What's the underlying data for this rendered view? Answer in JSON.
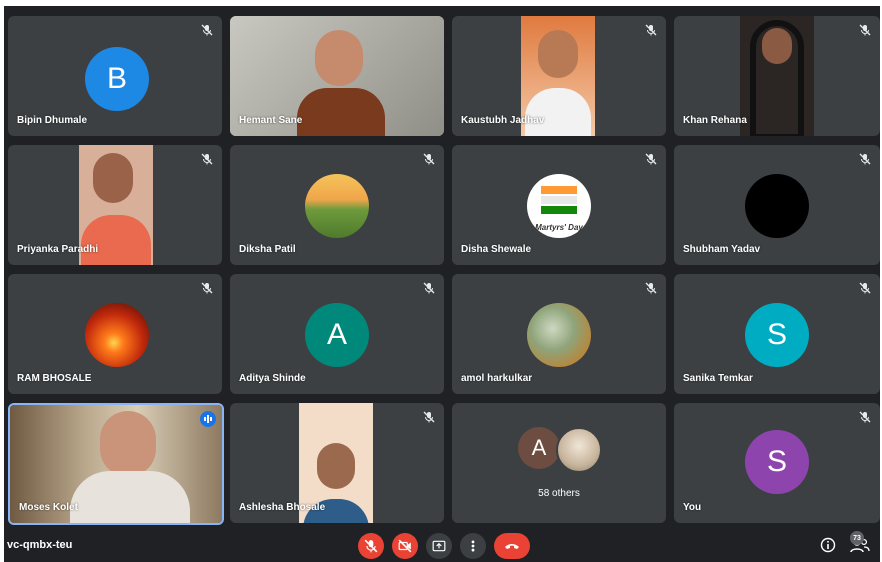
{
  "meeting": {
    "code": "vc-qmbx-teu",
    "participant_count": "73"
  },
  "tiles": [
    {
      "name": "Bipin Dhumale",
      "avatar_letter": "B",
      "avatar_color": "#1e88e5"
    },
    {
      "name": "Hemant Sane"
    },
    {
      "name": "Kaustubh Jadhav"
    },
    {
      "name": "Khan Rehana"
    },
    {
      "name": "Priyanka Paradhi"
    },
    {
      "name": "Diksha Patil"
    },
    {
      "name": "Disha Shewale",
      "avatar_text": "Martyrs' Day"
    },
    {
      "name": "Shubham Yadav"
    },
    {
      "name": "RAM BHOSALE"
    },
    {
      "name": "Aditya Shinde",
      "avatar_letter": "A",
      "avatar_color": "#00897b"
    },
    {
      "name": "amol harkulkar"
    },
    {
      "name": "Sanika Temkar",
      "avatar_letter": "S",
      "avatar_color": "#00acc1"
    },
    {
      "name": "Moses Kolet"
    },
    {
      "name": "Ashlesha Bhosale"
    },
    {
      "name": "58 others",
      "avatar_letter": "A",
      "avatar_color": "#6d4c41"
    },
    {
      "name": "You",
      "avatar_letter": "S",
      "avatar_color": "#8e44ad"
    }
  ],
  "colors": {
    "tile": "#3c4043",
    "background": "#202124",
    "accent_red": "#ea4335",
    "active_border": "#8ab4f8"
  }
}
